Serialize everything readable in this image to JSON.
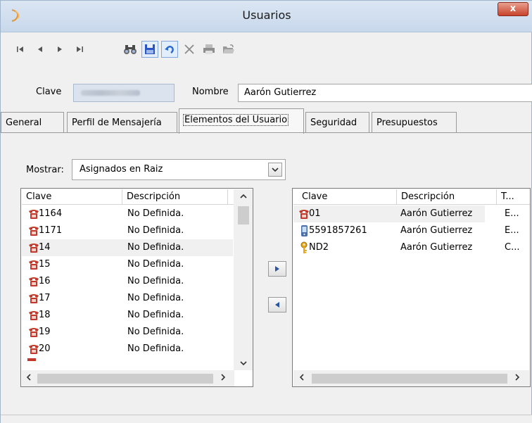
{
  "window": {
    "title": "Usuarios",
    "close": "x"
  },
  "header": {
    "clave_label": "Clave",
    "nombre_label": "Nombre",
    "nombre_value": "Aarón Gutierrez"
  },
  "tabs": [
    {
      "label": "General"
    },
    {
      "label": "Perfil de Mensajería"
    },
    {
      "label": "Elementos del Usuario"
    },
    {
      "label": "Seguridad"
    },
    {
      "label": "Presupuestos"
    }
  ],
  "filter": {
    "label": "Mostrar:",
    "value": "Asignados en Raiz"
  },
  "left_list": {
    "columns": [
      "Clave",
      "Descripción"
    ],
    "rows": [
      {
        "clave": "1164",
        "descripcion": "No Definida."
      },
      {
        "clave": "1171",
        "descripcion": "No Definida."
      },
      {
        "clave": "14",
        "descripcion": "No Definida."
      },
      {
        "clave": "15",
        "descripcion": "No Definida."
      },
      {
        "clave": "16",
        "descripcion": "No Definida."
      },
      {
        "clave": "17",
        "descripcion": "No Definida."
      },
      {
        "clave": "18",
        "descripcion": "No Definida."
      },
      {
        "clave": "19",
        "descripcion": "No Definida."
      },
      {
        "clave": "20",
        "descripcion": "No Definida."
      }
    ]
  },
  "right_list": {
    "columns": [
      "Clave",
      "Descripción",
      "T..."
    ],
    "rows": [
      {
        "clave": "01",
        "descripcion": "Aarón Gutierrez",
        "tipo": "E...",
        "icon": "phone-icon"
      },
      {
        "clave": "5591857261",
        "descripcion": "Aarón Gutierrez",
        "tipo": "E...",
        "icon": "mobile-icon"
      },
      {
        "clave": "ND2",
        "descripcion": "Aarón Gutierrez",
        "tipo": "C...",
        "icon": "key-icon"
      }
    ]
  },
  "colors": {
    "phone_red": "#c0392b",
    "accent": "#2a6ad1",
    "title_bar": "#dbe6f3"
  }
}
